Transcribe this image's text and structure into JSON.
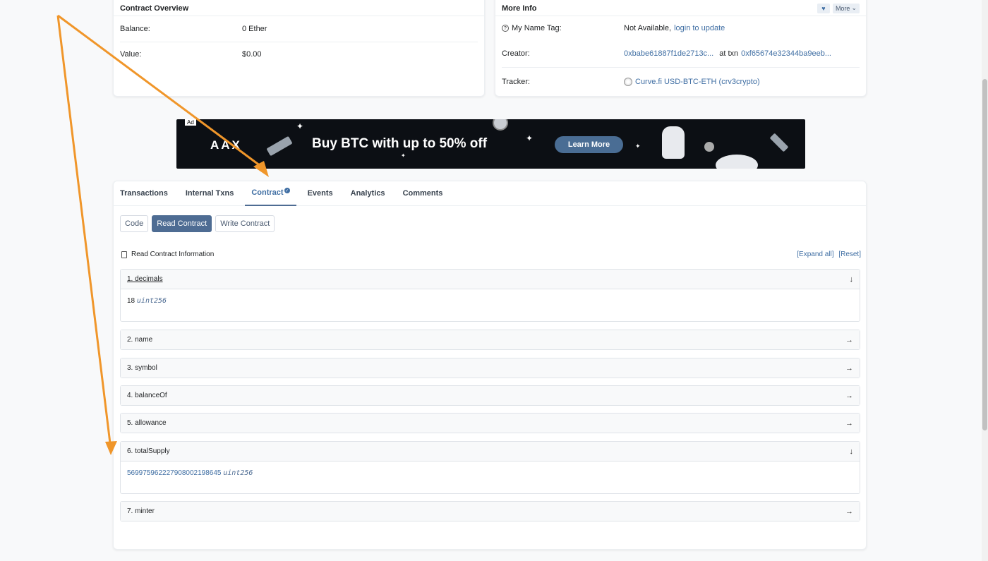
{
  "overview": {
    "title": "Contract Overview",
    "rows": [
      {
        "label": "Balance:",
        "value": "0 Ether"
      },
      {
        "label": "Value:",
        "value": "$0.00"
      }
    ]
  },
  "more_info": {
    "title": "More Info",
    "more_label": "More",
    "name_tag_label": "My Name Tag:",
    "name_tag_value": "Not Available,",
    "name_tag_link": "login to update",
    "creator_label": "Creator:",
    "creator_address": "0xbabe61887f1de2713c...",
    "creator_at": "at txn",
    "creator_txn": "0xf65674e32344ba9eeb...",
    "tracker_label": "Tracker:",
    "tracker_value": "Curve.fi USD-BTC-ETH (crv3crypto)"
  },
  "ad": {
    "badge": "Ad",
    "brand": "AAX",
    "headline": "Buy BTC with up to 50% off",
    "cta": "Learn More"
  },
  "tabs": [
    "Transactions",
    "Internal Txns",
    "Contract",
    "Events",
    "Analytics",
    "Comments"
  ],
  "subtabs": [
    "Code",
    "Read Contract",
    "Write Contract"
  ],
  "read_contract": {
    "title": "Read Contract Information",
    "expand_all": "[Expand all]",
    "reset": "[Reset]",
    "items": [
      {
        "label": "1. decimals",
        "value": "18",
        "type": "uint256"
      },
      {
        "label": "2. name"
      },
      {
        "label": "3. symbol"
      },
      {
        "label": "4. balanceOf"
      },
      {
        "label": "5. allowance"
      },
      {
        "label": "6. totalSupply",
        "value": "569975962227908002198645",
        "type": "uint256"
      },
      {
        "label": "7. minter"
      }
    ]
  },
  "colors": {
    "accent": "#4e6c93",
    "link": "#3f6ea3",
    "annotation": "#f0962a"
  }
}
